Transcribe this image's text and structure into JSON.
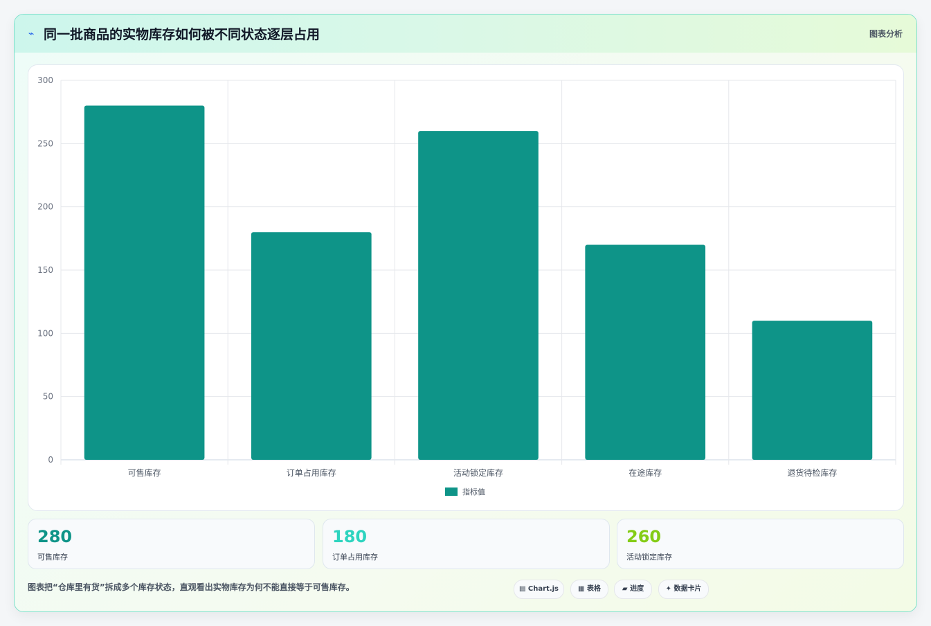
{
  "header": {
    "icon": "chart-line-icon",
    "icon_glyph": "⌁",
    "title": "同一批商品的实物库存如何被不同状态逐层占用",
    "tag": "图表分析"
  },
  "chart_data": {
    "type": "bar",
    "categories": [
      "可售库存",
      "订单占用库存",
      "活动锁定库存",
      "在途库存",
      "退货待检库存"
    ],
    "series": [
      {
        "name": "指标值",
        "values": [
          280,
          180,
          260,
          170,
          110
        ],
        "color": "#0e9488"
      }
    ],
    "yticks": [
      0,
      50,
      100,
      150,
      200,
      250,
      300
    ],
    "ylim": [
      0,
      300
    ],
    "grid": true,
    "legend": "bottom"
  },
  "stats": [
    {
      "value": "280",
      "label": "可售库存",
      "color": "#0e9488"
    },
    {
      "value": "180",
      "label": "订单占用库存",
      "color": "#2dd4bf"
    },
    {
      "value": "260",
      "label": "活动锁定库存",
      "color": "#84cc16"
    }
  ],
  "footer": {
    "note": "图表把“仓库里有货”拆成多个库存状态，直观看出实物库存为何不能直接等于可售库存。",
    "pills": [
      {
        "icon": "chart-icon",
        "glyph": "▤",
        "label": "Chart.js"
      },
      {
        "icon": "table-icon",
        "glyph": "▦",
        "label": "表格"
      },
      {
        "icon": "progress-icon",
        "glyph": "▰",
        "label": "进度"
      },
      {
        "icon": "sparkle-icon",
        "glyph": "✦",
        "label": "数据卡片"
      }
    ]
  }
}
